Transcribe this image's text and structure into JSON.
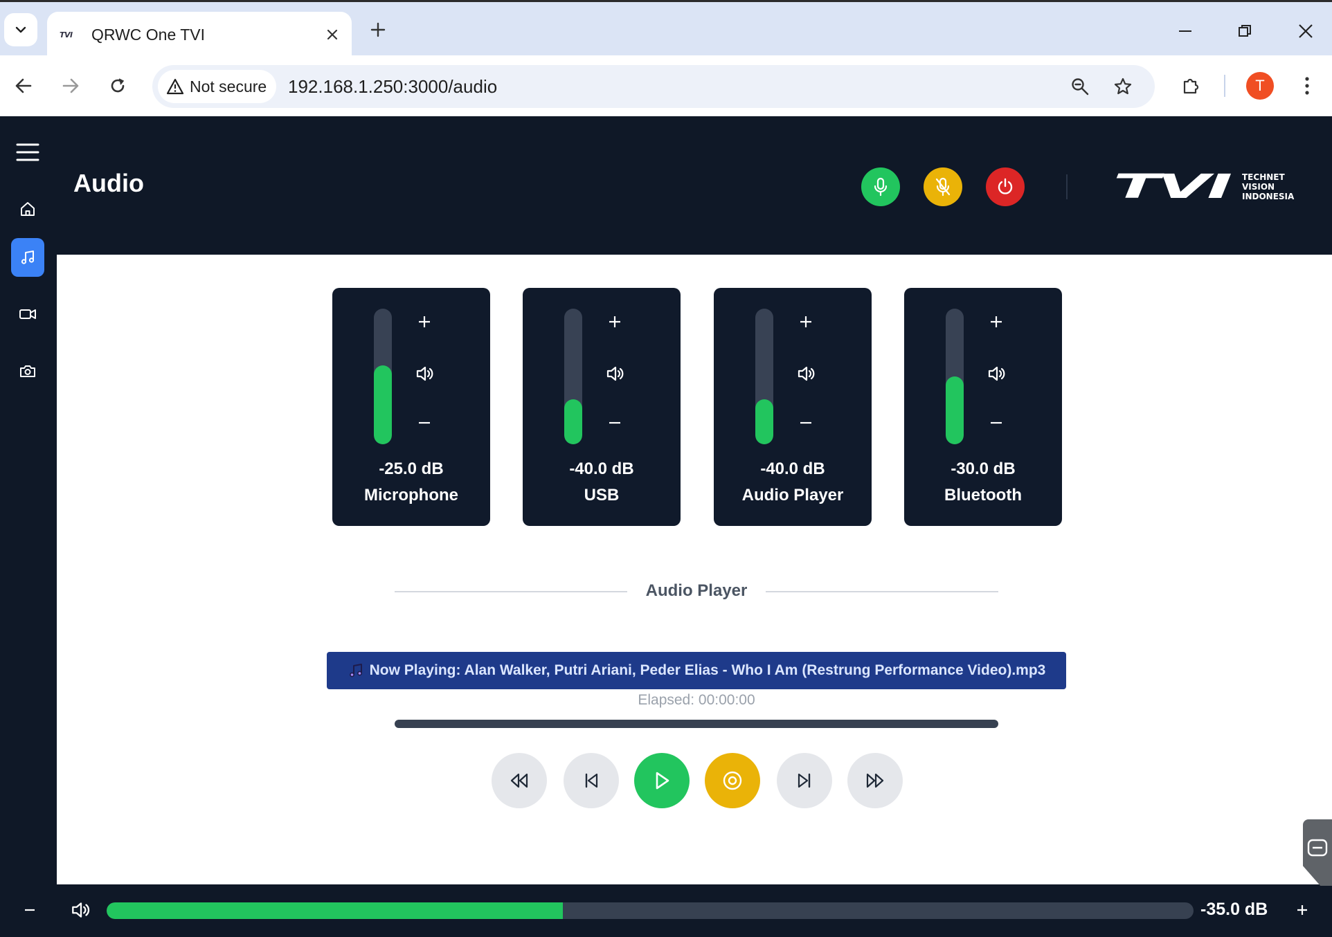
{
  "browser": {
    "tab_title": "QRWC One TVI",
    "favicon_text": "TVI",
    "security_label": "Not secure",
    "url": "192.168.1.250:3000/audio",
    "profile_initial": "T"
  },
  "header": {
    "title": "Audio",
    "logo_text": "TVI",
    "logo_tagline_1": "TECHNET",
    "logo_tagline_2": "VISION",
    "logo_tagline_3": "INDONESIA",
    "buttons": [
      {
        "name": "mic-on-button",
        "icon": "microphone-icon",
        "color": "#22c55e"
      },
      {
        "name": "mic-mute-button",
        "icon": "microphone-off-icon",
        "color": "#eab308"
      },
      {
        "name": "power-button",
        "icon": "power-icon",
        "color": "#dc2626"
      }
    ]
  },
  "sidebar": {
    "items": [
      {
        "name": "menu",
        "icon": "hamburger-icon"
      },
      {
        "name": "home",
        "icon": "home-icon"
      },
      {
        "name": "audio",
        "icon": "music-note-icon",
        "active": true
      },
      {
        "name": "video",
        "icon": "video-camera-icon"
      },
      {
        "name": "camera",
        "icon": "camera-icon"
      }
    ]
  },
  "channels": [
    {
      "db": "-25.0 dB",
      "name": "Microphone",
      "level": 0.58
    },
    {
      "db": "-40.0 dB",
      "name": "USB",
      "level": 0.33
    },
    {
      "db": "-40.0 dB",
      "name": "Audio Player",
      "level": 0.33
    },
    {
      "db": "-30.0 dB",
      "name": "Bluetooth",
      "level": 0.5
    }
  ],
  "player": {
    "section_title": "Audio Player",
    "now_playing": "Now Playing: Alan Walker, Putri Ariani, Peder Elias - Who I Am (Restrung Performance Video).mp3",
    "elapsed": "Elapsed: 00:00:00",
    "progress": 0,
    "controls": [
      "rewind",
      "previous",
      "play",
      "stop",
      "next",
      "fast-forward"
    ]
  },
  "master": {
    "db": "-35.0 dB",
    "level": 0.42
  },
  "colors": {
    "accent": "#3b82f6",
    "green": "#22c55e",
    "yellow": "#eab308",
    "red": "#dc2626",
    "dark": "#0f1827",
    "now_playing_bg": "#1e3a8a"
  }
}
